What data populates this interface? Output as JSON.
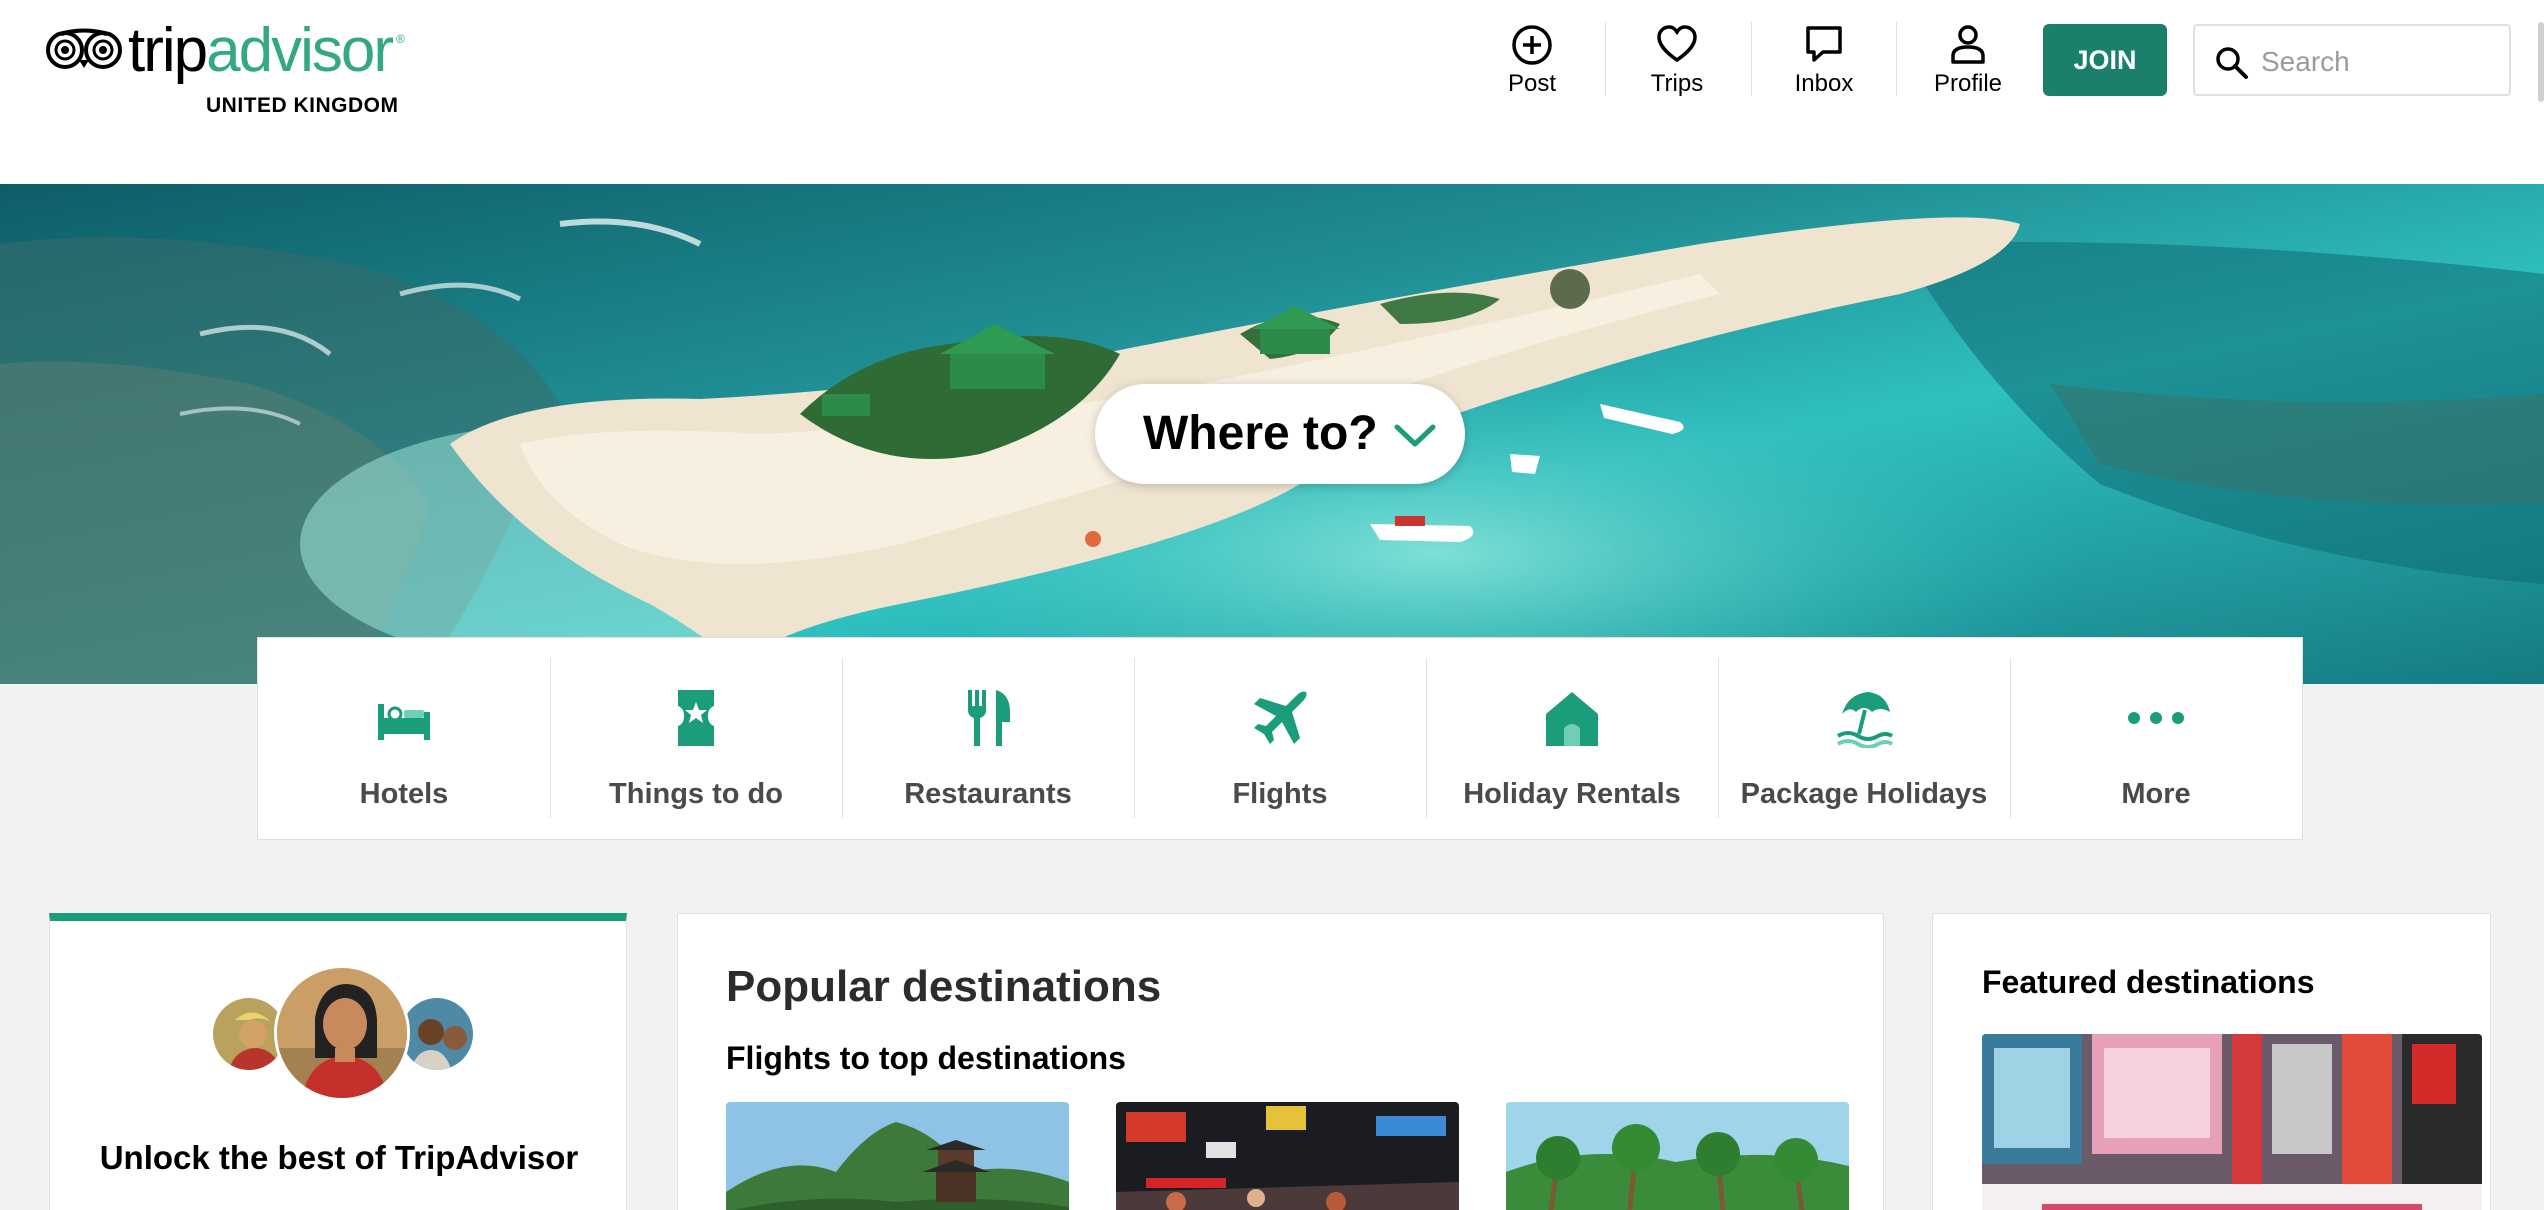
{
  "brand": {
    "name_part1": "trip",
    "name_part2": "advisor",
    "registered": "®",
    "region": "UNITED KINGDOM",
    "accent_color": "#34a784",
    "button_color": "#1b806b"
  },
  "header": {
    "nav": [
      {
        "label": "Post",
        "icon": "plus-circle-icon"
      },
      {
        "label": "Trips",
        "icon": "heart-icon"
      },
      {
        "label": "Inbox",
        "icon": "chat-bubble-icon"
      },
      {
        "label": "Profile",
        "icon": "person-icon"
      }
    ],
    "join_label": "JOIN",
    "search": {
      "placeholder": "Search",
      "value": ""
    }
  },
  "hero": {
    "where_to": "Where to?",
    "image": "aerial-beach-island-photo"
  },
  "categories": [
    {
      "label": "Hotels",
      "icon": "bed-icon"
    },
    {
      "label": "Things to do",
      "icon": "ticket-icon"
    },
    {
      "label": "Restaurants",
      "icon": "fork-knife-icon"
    },
    {
      "label": "Flights",
      "icon": "plane-icon"
    },
    {
      "label": "Holiday Rentals",
      "icon": "house-icon"
    },
    {
      "label": "Package Holidays",
      "icon": "beach-umbrella-icon"
    },
    {
      "label": "More",
      "icon": "dots-icon"
    }
  ],
  "unlock": {
    "title": "Unlock the best of TripAdvisor"
  },
  "popular": {
    "title": "Popular destinations",
    "subtitle": "Flights to top destinations",
    "thumbnails": [
      "pagoda-mountain-photo",
      "night-market-photo",
      "palm-beach-photo"
    ]
  },
  "featured": {
    "title": "Featured destinations",
    "image": "city-street-signs-photo"
  }
}
